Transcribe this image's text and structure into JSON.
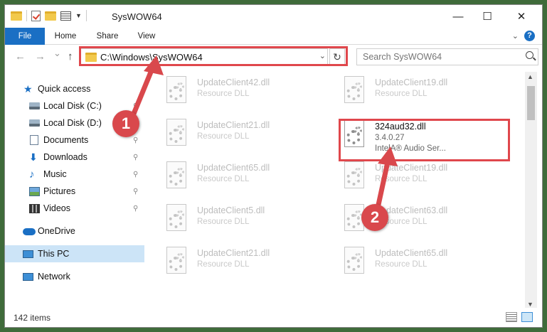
{
  "window": {
    "title": "SysWOW64",
    "minimize_glyph": "—",
    "maximize_glyph": "☐",
    "close_glyph": "✕"
  },
  "ribbon": {
    "tabs": [
      "File",
      "Home",
      "Share",
      "View"
    ]
  },
  "nav": {
    "back_glyph": "←",
    "forward_glyph": "→",
    "recent_glyph": "⌄",
    "up_glyph": "↑"
  },
  "address": {
    "path": "C:\\Windows\\SysWOW64",
    "refresh_glyph": "↻"
  },
  "search": {
    "placeholder": "Search SysWOW64"
  },
  "sidebar": {
    "items": [
      {
        "label": "Quick access",
        "icon": "star-icon",
        "pinned": false
      },
      {
        "label": "Local Disk (C:)",
        "icon": "drive-icon",
        "pinned": true
      },
      {
        "label": "Local Disk (D:)",
        "icon": "drive-icon",
        "pinned": true
      },
      {
        "label": "Documents",
        "icon": "documents-icon",
        "pinned": true
      },
      {
        "label": "Downloads",
        "icon": "downloads-icon",
        "pinned": true
      },
      {
        "label": "Music",
        "icon": "music-icon",
        "pinned": true
      },
      {
        "label": "Pictures",
        "icon": "pictures-icon",
        "pinned": true
      },
      {
        "label": "Videos",
        "icon": "videos-icon",
        "pinned": true
      },
      {
        "label": "OneDrive",
        "icon": "onedrive-icon",
        "pinned": false
      },
      {
        "label": "This PC",
        "icon": "this-pc-icon",
        "pinned": false,
        "selected": true
      },
      {
        "label": "Network",
        "icon": "network-icon",
        "pinned": false
      }
    ],
    "pin_glyph": "📌"
  },
  "files": {
    "left": [
      {
        "name": "UpdateClient42.dll",
        "type": "Resource DLL"
      },
      {
        "name": "UpdateClient21.dll",
        "type": "Resource DLL"
      },
      {
        "name": "UpdateClient65.dll",
        "type": "Resource DLL"
      },
      {
        "name": "UpdateClient5.dll",
        "type": "Resource DLL"
      },
      {
        "name": "UpdateClient21.dll",
        "type": "Resource DLL"
      }
    ],
    "right": [
      {
        "name": "UpdateClient19.dll",
        "type": "Resource DLL"
      },
      {
        "name": "324aud32.dll",
        "version": "3.4.0.27",
        "type": "IntelA® Audio Ser...",
        "highlighted": true
      },
      {
        "name": "UpdateClient19.dll",
        "type": "Resource DLL"
      },
      {
        "name": "UpdateClient63.dll",
        "type": "Resource DLL"
      },
      {
        "name": "UpdateClient65.dll",
        "type": "Resource DLL"
      }
    ]
  },
  "status": {
    "item_count": "142 items"
  },
  "annotations": {
    "step1": "1",
    "step2": "2",
    "color": "#d9484c"
  }
}
